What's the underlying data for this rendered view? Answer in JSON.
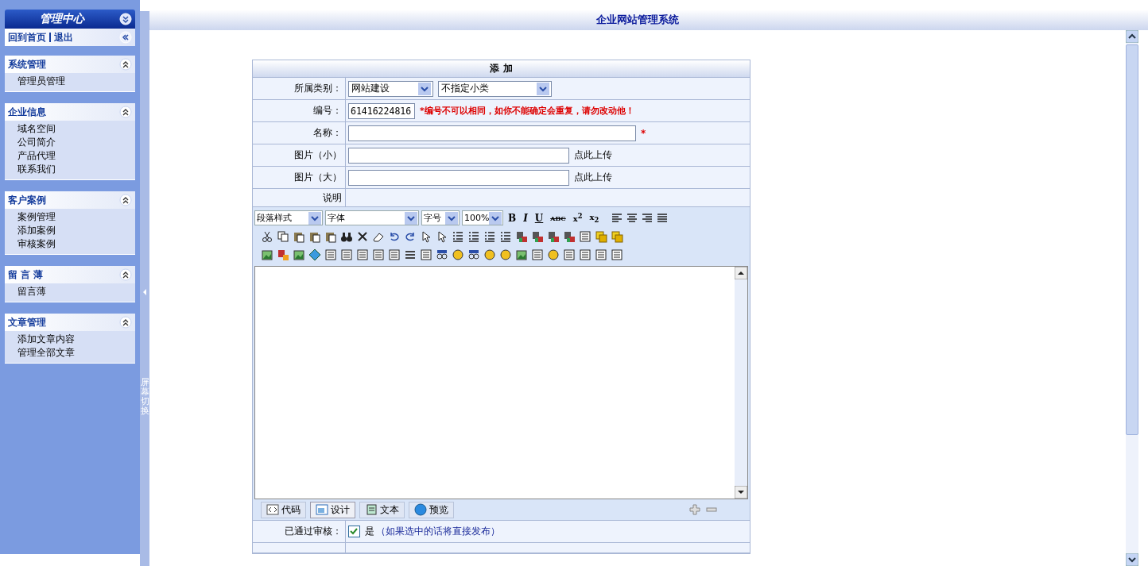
{
  "sidebar": {
    "title": "管理中心",
    "links": [
      "回到首页",
      "退出"
    ],
    "sections": [
      {
        "title": "系统管理",
        "expanded": true,
        "items": [
          "管理员管理"
        ]
      },
      {
        "title": "企业信息",
        "expanded": true,
        "items": [
          "域名空间",
          "公司简介",
          "产品代理",
          "联系我们"
        ]
      },
      {
        "title": "客户案例",
        "expanded": true,
        "items": [
          "案例管理",
          "添加案例",
          "审核案例"
        ]
      },
      {
        "title": "留 言 薄",
        "expanded": true,
        "items": [
          "留言薄"
        ]
      },
      {
        "title": "文章管理",
        "expanded": true,
        "items": [
          "添加文章内容",
          "管理全部文章"
        ]
      }
    ]
  },
  "splitter": {
    "label": "屏幕切换"
  },
  "header": {
    "title": "企业网站管理系统"
  },
  "form": {
    "title": "添 加",
    "category": {
      "label": "所属类别：",
      "main": "网站建设",
      "sub": "不指定小类"
    },
    "code": {
      "label": "编号：",
      "value": "61416224816",
      "warning": "*编号不可以相同，如你不能确定会重复，请勿改动他！"
    },
    "name": {
      "label": "名称：",
      "required_mark": "*"
    },
    "images": [
      {
        "label": "图片（小）",
        "upload": "点此上传"
      },
      {
        "label": "图片（大）",
        "upload": "点此上传"
      }
    ],
    "description": {
      "label": "说明"
    },
    "editor": {
      "selects": [
        "段落样式",
        "字体",
        "字号",
        "100%"
      ],
      "format_buttons": [
        "B",
        "I",
        "U",
        "ABC",
        "x$^{2}$",
        "x$_{2}$"
      ],
      "modes": [
        {
          "label": "代码",
          "selected": false
        },
        {
          "label": "设计",
          "selected": true
        },
        {
          "label": "文本",
          "selected": false
        },
        {
          "label": "预览",
          "selected": false
        }
      ]
    },
    "approved": {
      "label": "已通过审核：",
      "checked": true,
      "option": "是",
      "hint": "（如果选中的话将直接发布）"
    }
  }
}
